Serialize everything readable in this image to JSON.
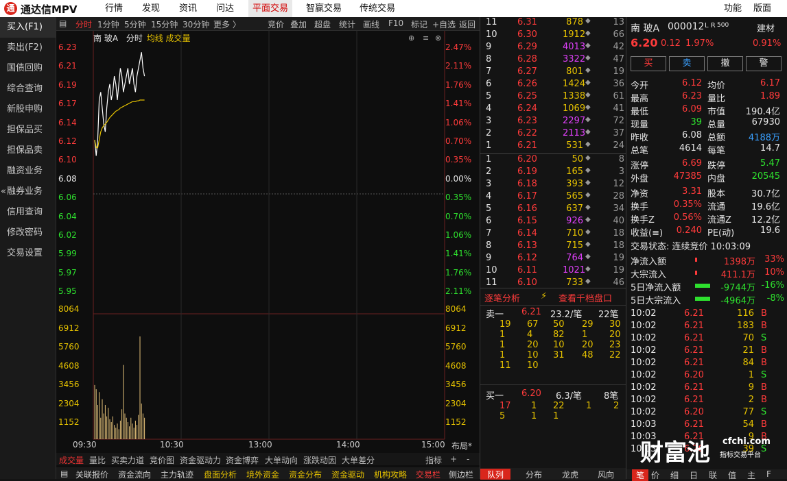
{
  "topbar": {
    "logo": "通",
    "app": "通达信MPV",
    "nav": [
      "行情",
      "发现",
      "资讯",
      "问达",
      "平面交易",
      "智赢交易",
      "传统交易"
    ],
    "right": [
      "功能",
      "版面"
    ]
  },
  "sidebar": [
    "买入(F1)",
    "卖出(F2)",
    "国债回购",
    "综合查询",
    "新股申购",
    "担保品买",
    "担保品卖",
    "融资业务",
    "融券业务",
    "信用查询",
    "修改密码",
    "交易设置"
  ],
  "sidebar_marker": "«",
  "chart_toolbar": {
    "left": [
      "分时",
      "1分钟",
      "5分钟",
      "15分钟",
      "30分钟",
      "更多 〉"
    ],
    "right": [
      "竞价",
      "叠加",
      "超盘",
      "统计",
      "画线",
      "F10",
      "标记",
      "+自选",
      "返回"
    ]
  },
  "chart_head": {
    "name": "南 玻A",
    "mode": "分时",
    "avg": "均线",
    "vol": "成交量"
  },
  "price_axis": {
    "left": [
      "6.23",
      "6.21",
      "6.19",
      "6.17",
      "6.14",
      "6.12",
      "6.10",
      "6.08",
      "6.06",
      "6.04",
      "6.02",
      "5.99",
      "5.97",
      "5.95"
    ],
    "right": [
      "2.47%",
      "2.11%",
      "1.76%",
      "1.41%",
      "1.06%",
      "0.70%",
      "0.35%",
      "0.00%",
      "0.35%",
      "0.70%",
      "1.06%",
      "1.41%",
      "1.76%",
      "2.11%"
    ]
  },
  "vol_axis": [
    "8064",
    "6912",
    "5760",
    "4608",
    "3456",
    "2304",
    "1152"
  ],
  "time_axis": [
    "09:30",
    "10:30",
    "13:00",
    "14:00",
    "15:00"
  ],
  "layout_btn": "布局*",
  "chart_data": {
    "type": "line",
    "x": [
      "09:30",
      "09:31",
      "09:32",
      "09:33",
      "09:34",
      "09:35",
      "09:36",
      "09:37",
      "09:38",
      "09:39",
      "09:40",
      "09:41",
      "09:42",
      "09:43",
      "09:44",
      "09:45",
      "09:46",
      "09:47",
      "09:48",
      "09:49",
      "09:50",
      "09:51",
      "09:52",
      "09:53",
      "09:54",
      "09:55",
      "09:56",
      "09:57",
      "09:58",
      "09:59",
      "10:00",
      "10:01",
      "10:02",
      "10:03"
    ],
    "series": [
      {
        "name": "",
        "values": [
          6.12,
          6.1,
          6.12,
          6.17,
          6.18,
          6.16,
          6.14,
          6.13,
          6.16,
          6.18,
          6.19,
          6.17,
          6.18,
          6.2,
          6.19,
          6.17,
          6.19,
          6.21,
          6.2,
          6.18,
          6.19,
          6.2,
          6.21,
          6.19,
          6.2,
          6.21,
          6.19,
          6.18,
          6.2,
          6.21,
          6.22,
          6.23,
          6.21,
          6.2
        ]
      },
      {
        "name": "均线",
        "values": [
          6.12,
          6.11,
          6.11,
          6.12,
          6.13,
          6.135,
          6.138,
          6.14,
          6.142,
          6.145,
          6.148,
          6.15,
          6.152,
          6.154,
          6.156,
          6.157,
          6.158,
          6.16,
          6.161,
          6.162,
          6.163,
          6.164,
          6.165,
          6.166,
          6.167,
          6.168,
          6.168,
          6.168,
          6.169,
          6.169,
          6.17,
          6.17,
          6.17,
          6.17
        ]
      },
      {
        "name": "成交量",
        "values": [
          3800,
          3500,
          2400,
          3300,
          1500,
          2800,
          1800,
          2400,
          1600,
          2200,
          1400,
          1200,
          1600,
          1000,
          800,
          1100,
          700,
          1300,
          2100,
          5200,
          1800,
          1500,
          1200,
          900,
          1500,
          1100,
          800,
          1300,
          1000,
          1700,
          7200,
          2500,
          1800,
          1500
        ]
      }
    ],
    "ylim": [
      5.93,
      6.25
    ],
    "vol_max": 8064
  },
  "bottom_tabs": [
    "成交量",
    "量比",
    "买卖力道",
    "竞价图",
    "资金驱动力",
    "资金博弈",
    "大单动向",
    "涨跌动因",
    "大单差分",
    "指标",
    "+",
    "-"
  ],
  "bottom_bar": [
    "关联报价",
    "资金流向",
    "主力轨迹",
    "盘面分析",
    "境外资金",
    "资金分布",
    "资金驱动",
    "机构攻略",
    "交易栏",
    "侧边栏"
  ],
  "sell_book": [
    {
      "n": "11",
      "p": "6.31",
      "v": "878",
      "c": "13"
    },
    {
      "n": "10",
      "p": "6.30",
      "v": "1912",
      "c": "66"
    },
    {
      "n": "9",
      "p": "6.29",
      "v": "4013",
      "c": "42"
    },
    {
      "n": "8",
      "p": "6.28",
      "v": "3322",
      "c": "47"
    },
    {
      "n": "7",
      "p": "6.27",
      "v": "801",
      "c": "19"
    },
    {
      "n": "6",
      "p": "6.26",
      "v": "1424",
      "c": "36"
    },
    {
      "n": "5",
      "p": "6.25",
      "v": "1338",
      "c": "61"
    },
    {
      "n": "4",
      "p": "6.24",
      "v": "1069",
      "c": "41"
    },
    {
      "n": "3",
      "p": "6.23",
      "v": "2297",
      "c": "72"
    },
    {
      "n": "2",
      "p": "6.22",
      "v": "2113",
      "c": "37"
    },
    {
      "n": "1",
      "p": "6.21",
      "v": "531",
      "c": "24"
    }
  ],
  "buy_book": [
    {
      "n": "1",
      "p": "6.20",
      "v": "50",
      "c": "8"
    },
    {
      "n": "2",
      "p": "6.19",
      "v": "165",
      "c": "3"
    },
    {
      "n": "3",
      "p": "6.18",
      "v": "393",
      "c": "12"
    },
    {
      "n": "4",
      "p": "6.17",
      "v": "565",
      "c": "28"
    },
    {
      "n": "5",
      "p": "6.16",
      "v": "637",
      "c": "34"
    },
    {
      "n": "6",
      "p": "6.15",
      "v": "926",
      "c": "40"
    },
    {
      "n": "7",
      "p": "6.14",
      "v": "710",
      "c": "18"
    },
    {
      "n": "8",
      "p": "6.13",
      "v": "715",
      "c": "18"
    },
    {
      "n": "9",
      "p": "6.12",
      "v": "764",
      "c": "19"
    },
    {
      "n": "10",
      "p": "6.11",
      "v": "1021",
      "c": "19"
    },
    {
      "n": "11",
      "p": "6.10",
      "v": "733",
      "c": "46"
    }
  ],
  "tick_analysis": {
    "title": "逐笔分析",
    "link": "查看千档盘口",
    "sell_label": "卖一",
    "sell_price": "6.21",
    "sell_avg": "23.2/笔",
    "sell_count": "22笔",
    "sell_rows": [
      [
        "19",
        "67",
        "50",
        "29",
        "30"
      ],
      [
        "1",
        "4",
        "82",
        "1",
        "20"
      ],
      [
        "1",
        "20",
        "10",
        "20",
        "23"
      ],
      [
        "1",
        "10",
        "31",
        "48",
        "22"
      ],
      [
        "11",
        "10",
        "",
        "",
        ""
      ]
    ],
    "buy_label": "买一",
    "buy_price": "6.20",
    "buy_avg": "6.3/笔",
    "buy_count": "8笔",
    "buy_rows": [
      [
        "17",
        "1",
        "22",
        "1",
        "2"
      ],
      [
        "5",
        "1",
        "1",
        "",
        ""
      ]
    ],
    "tabs": [
      "队列",
      "分布",
      "龙虎",
      "风向"
    ]
  },
  "quote": {
    "name": "南 玻A",
    "code": "000012",
    "tag": "L R",
    "lot": "500",
    "sector": "建材",
    "price": "6.20",
    "chg": "0.12",
    "pct": "1.97%",
    "pct2": "0.91%",
    "trade_btns": [
      "买",
      "卖",
      "撤",
      "警"
    ],
    "rows": [
      [
        "今开",
        "6.12",
        "均价",
        "6.17"
      ],
      [
        "最高",
        "6.23",
        "量比",
        "1.89"
      ],
      [
        "最低",
        "6.09",
        "市值",
        "190.4亿"
      ],
      [
        "现量",
        "39",
        "总量",
        "67930"
      ],
      [
        "昨收",
        "6.08",
        "总额",
        "4188万"
      ],
      [
        "总笔",
        "4614",
        "每笔",
        "14.7"
      ],
      [
        "涨停",
        "6.69",
        "跌停",
        "5.47"
      ],
      [
        "外盘",
        "47385",
        "内盘",
        "20545"
      ],
      [
        "净资",
        "3.31",
        "股本",
        "30.7亿"
      ],
      [
        "换手",
        "0.35%",
        "流通",
        "19.6亿"
      ],
      [
        "换手Z",
        "0.56%",
        "流通Z",
        "12.2亿"
      ],
      [
        "收益(≡)",
        "0.240",
        "PE(动)",
        "19.6"
      ]
    ],
    "status": "交易状态: 连续竞价 10:03:09",
    "flows": [
      [
        "净流入额",
        "1398万",
        "33%"
      ],
      [
        "大宗流入",
        "411.1万",
        "10%"
      ],
      [
        "5日净流入额",
        "-9744万",
        "-16%"
      ],
      [
        "5日大宗流入",
        "-4964万",
        "-8%"
      ]
    ],
    "trades": [
      [
        "10:02",
        "6.21",
        "116",
        "B"
      ],
      [
        "10:02",
        "6.21",
        "183",
        "B"
      ],
      [
        "10:02",
        "6.21",
        "70",
        "S"
      ],
      [
        "10:02",
        "6.21",
        "21",
        "B"
      ],
      [
        "10:02",
        "6.21",
        "84",
        "B"
      ],
      [
        "10:02",
        "6.20",
        "1",
        "S"
      ],
      [
        "10:02",
        "6.21",
        "9",
        "B"
      ],
      [
        "10:02",
        "6.21",
        "2",
        "B"
      ],
      [
        "10:02",
        "6.20",
        "77",
        "S"
      ],
      [
        "10:03",
        "6.21",
        "54",
        "B"
      ],
      [
        "10:03",
        "6.21",
        "9",
        "B"
      ],
      [
        "10:03",
        "6.20",
        "39",
        "S"
      ]
    ],
    "tabs": [
      "笔",
      "价",
      "细",
      "日",
      "联",
      "值",
      "主",
      "F"
    ]
  },
  "watermark": {
    "text": "财富池",
    "site": "cfchi.com",
    "sub": "指标交易平台"
  }
}
